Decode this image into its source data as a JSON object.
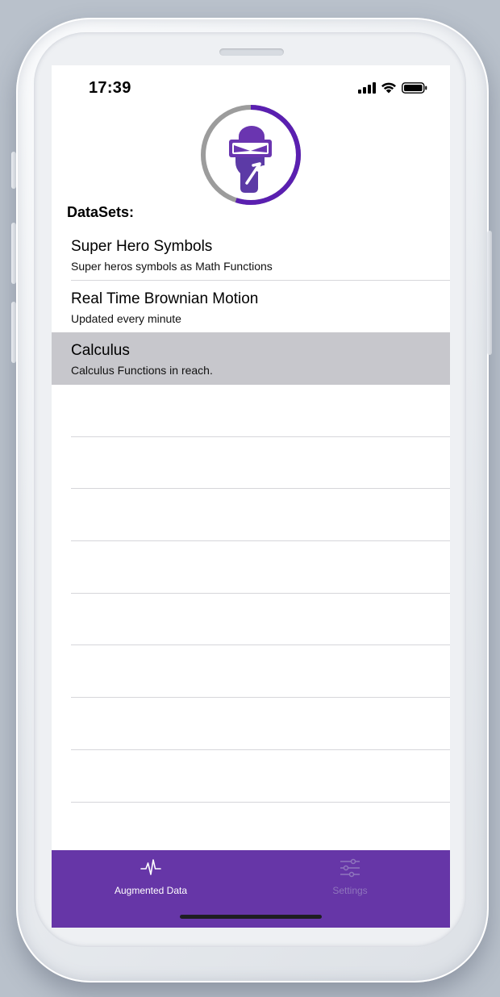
{
  "status_bar": {
    "time": "17:39",
    "icons": [
      "cellular-signal-icon",
      "wifi-icon",
      "battery-icon"
    ]
  },
  "logo": {
    "icon": "superhero-mask-logo-icon",
    "ring_progress": 0.55,
    "colors": {
      "ring_accent": "#5a1fb0",
      "ring_track": "#9c9c9c",
      "mask": "#6a35b0"
    }
  },
  "section_label": "DataSets:",
  "datasets": [
    {
      "title": "Super Hero Symbols",
      "subtitle": "Super heros symbols as Math Functions",
      "selected": false
    },
    {
      "title": "Real Time Brownian Motion",
      "subtitle": "Updated every minute",
      "selected": false
    },
    {
      "title": "Calculus",
      "subtitle": "Calculus Functions in reach.",
      "selected": true
    }
  ],
  "tab_bar": {
    "tabs": [
      {
        "label": "Augmented Data",
        "icon": "pulse-waveform-icon",
        "active": true
      },
      {
        "label": "Settings",
        "icon": "sliders-icon",
        "active": false
      }
    ],
    "colors": {
      "background": "#6636a7",
      "active": "#ffffff",
      "inactive": "#8f76bd"
    }
  }
}
